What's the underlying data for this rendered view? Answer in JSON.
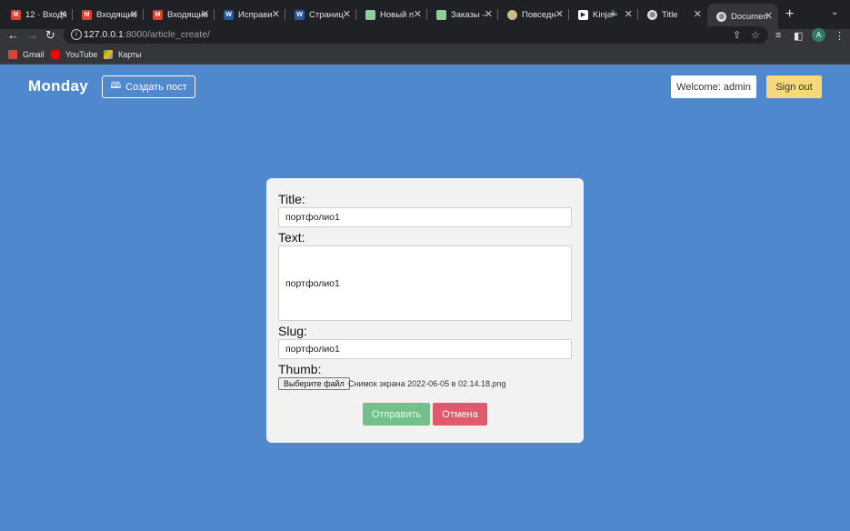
{
  "browser": {
    "tabs": [
      {
        "title": "12 · Входя",
        "icon": "gmail-icon",
        "color": "#d44638"
      },
      {
        "title": "Входящие",
        "icon": "gmail-icon",
        "color": "#d44638"
      },
      {
        "title": "Входящие",
        "icon": "gmail-icon",
        "color": "#d44638"
      },
      {
        "title": "Исправи",
        "icon": "word-icon",
        "color": "#2b579a"
      },
      {
        "title": "Страниц",
        "icon": "word-icon",
        "color": "#2b579a"
      },
      {
        "title": "Новый п",
        "icon": "sheet-icon",
        "color": "#8fcf9e"
      },
      {
        "title": "Заказы –",
        "icon": "sheet-icon",
        "color": "#8fcf9e"
      },
      {
        "title": "Повседн",
        "icon": "circle-icon",
        "color": "#c7b98a"
      },
      {
        "title": "Kinja",
        "icon": "play-icon",
        "color": "#ffffff"
      },
      {
        "title": "Title",
        "icon": "globe-icon",
        "color": "#d9d9d9"
      },
      {
        "title": "Documen",
        "icon": "globe-icon",
        "color": "#d9d9d9"
      }
    ],
    "url_host": "127.0.0.1",
    "url_path": ":8000/article_create/",
    "profile_initial": "A",
    "bookmarks": [
      {
        "label": "Gmail",
        "icon": "gmail-icon"
      },
      {
        "label": "YouTube",
        "icon": "youtube-icon"
      },
      {
        "label": "Карты",
        "icon": "maps-icon"
      }
    ]
  },
  "header": {
    "logo": "Monday",
    "create_post": "Создать пост",
    "welcome": "Welcome: admin",
    "sign_out": "Sign out"
  },
  "form": {
    "title_label": "Title:",
    "title_value": "портфолио1",
    "text_label": "Text:",
    "text_value": "портфолио1",
    "slug_label": "Slug:",
    "slug_value": "портфолио1",
    "thumb_label": "Thumb:",
    "file_button": "Выберите файл",
    "file_name": "Снимок экрана 2022-06-05 в 02.14.18.png",
    "submit": "Отправить",
    "cancel": "Отмена"
  },
  "colors": {
    "page_bg": "#4f88cc",
    "submit_bg": "#74c08b",
    "cancel_bg": "#e05a6e",
    "signout_bg": "#f5d97a"
  }
}
